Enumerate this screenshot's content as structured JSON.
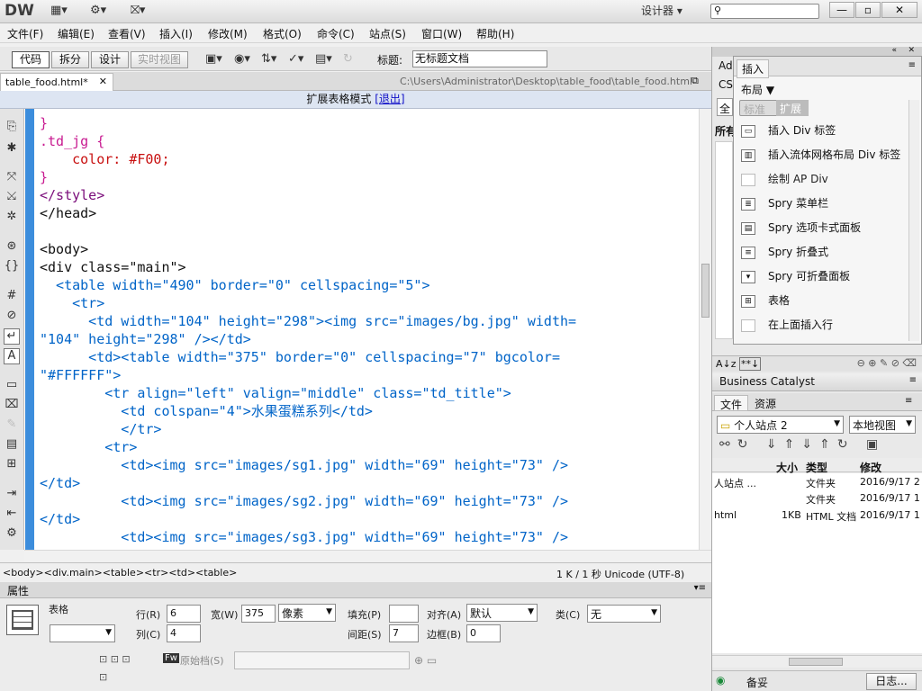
{
  "app": {
    "logo": "DW",
    "workspace": "设计器",
    "search_placeholder": ""
  },
  "window_controls": {
    "minimize": "—",
    "restore": "▫",
    "close": "✕"
  },
  "menu": [
    "文件(F)",
    "编辑(E)",
    "查看(V)",
    "插入(I)",
    "修改(M)",
    "格式(O)",
    "命令(C)",
    "站点(S)",
    "窗口(W)",
    "帮助(H)"
  ],
  "toolbar": {
    "code": "代码",
    "split": "拆分",
    "design": "设计",
    "live": "实时视图",
    "title_label": "标题:",
    "title_value": "无标题文档"
  },
  "document": {
    "tab": "table_food.html*",
    "path": "C:\\Users\\Administrator\\Desktop\\table_food\\table_food.html",
    "mode_text": "扩展表格模式",
    "exit_link": "[退出]"
  },
  "code_lines": [
    "}",
    ".td_jg {",
    "    color: #F00;",
    "}",
    "</style>",
    "</head>",
    "",
    "<body>",
    "<div class=\"main\">",
    "  <table width=\"490\" border=\"0\" cellspacing=\"5\">",
    "    <tr>",
    "      <td width=\"104\" height=\"298\"><img src=\"images/bg.jpg\" width=",
    "\"104\" height=\"298\" /></td>",
    "      <td><table width=\"375\" border=\"0\" cellspacing=\"7\" bgcolor=",
    "\"#FFFFFF\">",
    "        <tr align=\"left\" valign=\"middle\" class=\"td_title\">",
    "          <td colspan=\"4\">水果蛋糕系列</td>",
    "          </tr>",
    "        <tr>",
    "          <td><img src=\"images/sg1.jpg\" width=\"69\" height=\"73\" />",
    "</td>",
    "          <td><img src=\"images/sg2.jpg\" width=\"69\" height=\"73\" />",
    "</td>",
    "          <td><img src=\"images/sg3.jpg\" width=\"69\" height=\"73\" />"
  ],
  "status": {
    "breadcrumb": "<body><div.main><table><tr><td><table>",
    "info": "1 K / 1 秒  Unicode (UTF-8)"
  },
  "properties": {
    "header": "属性",
    "type": "表格",
    "rows_label": "行(R)",
    "rows": "6",
    "width_label": "宽(W)",
    "width": "375",
    "unit": "像素",
    "padding_label": "填充(P)",
    "padding": "",
    "align_label": "对齐(A)",
    "align": "默认",
    "class_label": "类(C)",
    "class": "无",
    "cols_label": "列(C)",
    "cols": "4",
    "spacing_label": "间距(S)",
    "spacing": "7",
    "border_label": "边框(B)",
    "border": "0",
    "source_label": "原始档(S)"
  },
  "insert_panel": {
    "title": "插入",
    "category": "布局",
    "tab_standard": "标准",
    "tab_expanded": "扩展",
    "items": [
      "插入 Div 标签",
      "插入流体网格布局 Div 标签",
      "绘制 AP Div",
      "Spry 菜单栏",
      "Spry 选项卡式面板",
      "Spry 折叠式",
      "Spry 可折叠面板",
      "表格",
      "在上面插入行"
    ]
  },
  "css_panel": {
    "tab1": "Ad",
    "tab2": "CS",
    "all": "全",
    "all_label": "所有"
  },
  "bc_panel": {
    "title": "Business Catalyst"
  },
  "files_panel": {
    "tab_files": "文件",
    "tab_assets": "资源",
    "site": "个人站点 2",
    "view": "本地视图",
    "columns": [
      "大小",
      "类型",
      "修改"
    ],
    "rows": [
      {
        "name": "人站点 ...",
        "size": "",
        "type": "文件夹",
        "modified": "2016/9/17 2"
      },
      {
        "name": "",
        "size": "",
        "type": "文件夹",
        "modified": "2016/9/17 1"
      },
      {
        "name": "html",
        "size": "1KB",
        "type": "HTML 文档",
        "modified": "2016/9/17 1"
      }
    ],
    "status": "备妥",
    "log_button": "日志..."
  }
}
